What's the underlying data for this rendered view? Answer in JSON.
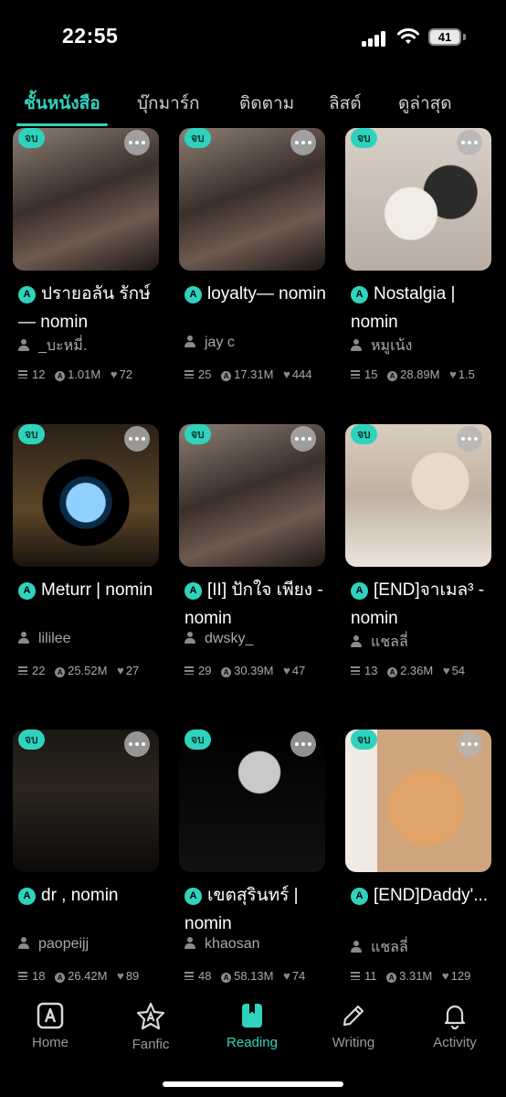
{
  "status": {
    "time": "22:55",
    "battery": "41"
  },
  "tabs": [
    {
      "label": "ชั้นหนังสือ",
      "active": true
    },
    {
      "label": "บุ๊กมาร์ก"
    },
    {
      "label": "ติดตาม"
    },
    {
      "label": "ลิสต์"
    },
    {
      "label": "ดูล่าสุด"
    }
  ],
  "colors": {
    "accent": "#2fd3bd",
    "background": "#000000",
    "muted": "#a9a9a9"
  },
  "cards": [
    {
      "badge": "จบ",
      "title": "ปรายอลัน รักษ์ — nomin",
      "author": "_บะหมี่.",
      "chapters": "12",
      "views": "1.01M",
      "likes": "72",
      "cover": "photo"
    },
    {
      "badge": "จบ",
      "title": "loyalty— nomin",
      "author": "jay c",
      "chapters": "25",
      "views": "17.31M",
      "likes": "444",
      "cover": "photo"
    },
    {
      "badge": "จบ",
      "title": "Nostalgia | nomin",
      "author": "หมูเน้ง",
      "chapters": "15",
      "views": "28.89M",
      "likes": "1.5",
      "cover": "kittens"
    },
    {
      "badge": "จบ",
      "title": "Meturr | nomin",
      "author": "lililee",
      "chapters": "22",
      "views": "25.52M",
      "likes": "27",
      "cover": "scope"
    },
    {
      "badge": "จบ",
      "title": "[II] ปักใจ เพียง - nomin",
      "author": "dwsky_",
      "chapters": "29",
      "views": "30.39M",
      "likes": "47",
      "cover": "photo"
    },
    {
      "badge": "จบ",
      "title": "[END]จาเมล³ - nomin",
      "author": "แชลลี่",
      "chapters": "13",
      "views": "2.36M",
      "likes": "54",
      "cover": "selfie"
    },
    {
      "badge": "จบ",
      "title": "dr , nomin",
      "author": "paopeijj",
      "chapters": "18",
      "views": "26.42M",
      "likes": "89",
      "cover": "dark"
    },
    {
      "badge": "จบ",
      "title": "เขตสุรินทร์ | nomin",
      "author": "khaosan",
      "chapters": "48",
      "views": "58.13M",
      "likes": "74",
      "cover": "silver"
    },
    {
      "badge": "จบ",
      "title": "[END]Daddy'...",
      "author": "แชลลี่",
      "chapters": "11",
      "views": "3.31M",
      "likes": "129",
      "cover": "cat"
    }
  ],
  "nav": [
    {
      "label": "Home",
      "icon": "home-a-icon"
    },
    {
      "label": "Fanfic",
      "icon": "fanfic-star-icon"
    },
    {
      "label": "Reading",
      "icon": "bookmark-book-icon",
      "active": true
    },
    {
      "label": "Writing",
      "icon": "pencil-icon"
    },
    {
      "label": "Activity",
      "icon": "bell-icon"
    }
  ]
}
